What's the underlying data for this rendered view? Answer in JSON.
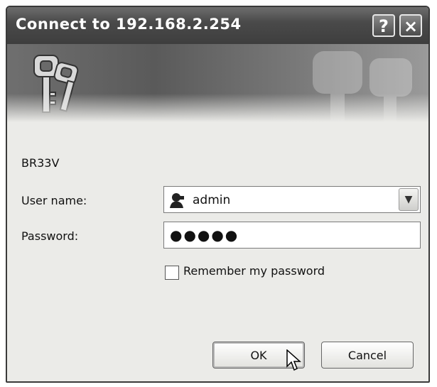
{
  "window": {
    "title": "Connect to 192.168.2.254",
    "help_label": "?",
    "close_label": "×"
  },
  "banner": {
    "icon": "keys-icon"
  },
  "server_name": "BR33V",
  "form": {
    "username_label": "User name:",
    "username_value": "admin",
    "password_label": "Password:",
    "password_value": "●●●●●",
    "remember_label": "Remember my password",
    "remember_checked": false
  },
  "buttons": {
    "ok": "OK",
    "cancel": "Cancel"
  },
  "icons": {
    "user": "user-icon",
    "dropdown": "chevron-down-icon",
    "cursor": "mouse-pointer-icon"
  }
}
